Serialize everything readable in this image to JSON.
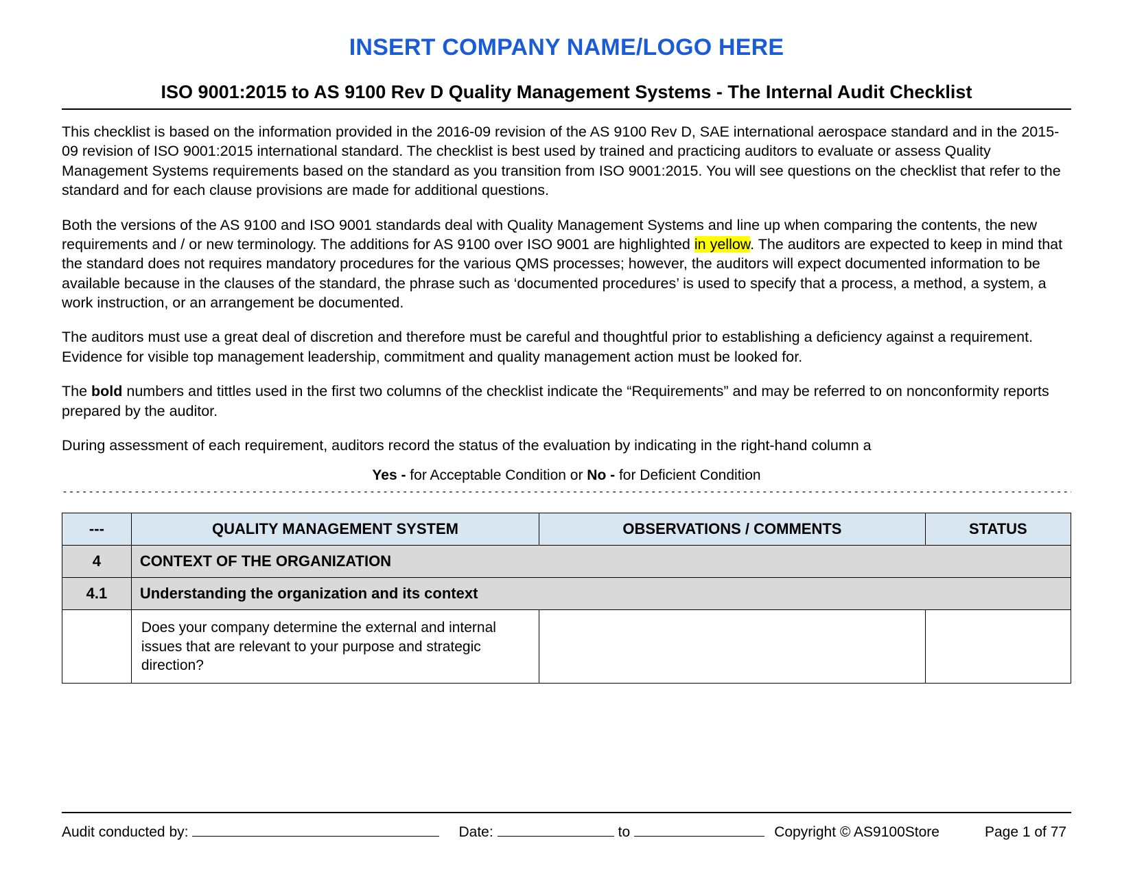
{
  "header": {
    "company_placeholder": "INSERT COMPANY NAME/LOGO HERE",
    "doc_title": "ISO 9001:2015 to AS 9100 Rev D  Quality Management Systems - The Internal Audit Checklist"
  },
  "intro": {
    "p1": "This checklist is based on the information provided in the 2016-09 revision of the AS 9100 Rev D, SAE international aerospace standard and in the 2015-09 revision of ISO 9001:2015 international standard. The checklist is best used by trained and practicing auditors to evaluate or assess Quality Management Systems requirements based on the standard as you transition from ISO 9001:2015. You will see questions on the checklist that refer to the standard and for each clause provisions are made for additional questions.",
    "p2_a": "Both the versions of the AS 9100 and ISO 9001 standards deal with Quality Management Systems and line up when comparing the contents, the new requirements and / or new terminology. The additions for AS 9100 over ISO 9001 are highlighted ",
    "p2_highlight": "in yellow",
    "p2_b": ". The auditors are expected to keep in mind that the standard does not requires mandatory procedures for the various QMS processes; however, the auditors will expect documented information to be available because in the clauses of the standard, the phrase such as ‘documented procedures’ is used to specify that a process, a method, a system, a work instruction, or an arrangement be documented.",
    "p3": "The auditors must use a great deal of discretion and therefore must be careful and thoughtful prior to establishing a deficiency against a requirement.  Evidence for visible top management leadership, commitment and quality management action must be looked for.",
    "p4_a": "The ",
    "p4_bold": "bold",
    "p4_b": " numbers and tittles used in the first two columns of the checklist indicate the “Requirements” and may be referred to on nonconformity reports prepared by the auditor.",
    "p5": "During assessment of each requirement, auditors record the status of the evaluation by indicating in the right-hand column a",
    "legend_yes": "Yes -",
    "legend_yes_txt": " for Acceptable Condition or ",
    "legend_no": "No -",
    "legend_no_txt": " for Deficient Condition"
  },
  "table": {
    "headers": {
      "col1": "---",
      "col2": "QUALITY MANAGEMENT SYSTEM",
      "col3": "OBSERVATIONS / COMMENTS",
      "col4": "STATUS"
    },
    "rows": [
      {
        "type": "section",
        "num": "4",
        "label": "CONTEXT OF THE ORGANIZATION"
      },
      {
        "type": "section",
        "num": "4.1",
        "label": "Understanding the organization and its context"
      },
      {
        "type": "question",
        "num": "",
        "qms": "Does your company determine the external and internal issues that are relevant to your purpose and strategic direction?",
        "obs": "",
        "status": ""
      }
    ]
  },
  "footer": {
    "audit_by_label": "Audit conducted by:",
    "date_label": "Date:",
    "to_label": "to",
    "copyright": "Copyright © AS9100Store",
    "page_label": "Page 1 of 77"
  }
}
